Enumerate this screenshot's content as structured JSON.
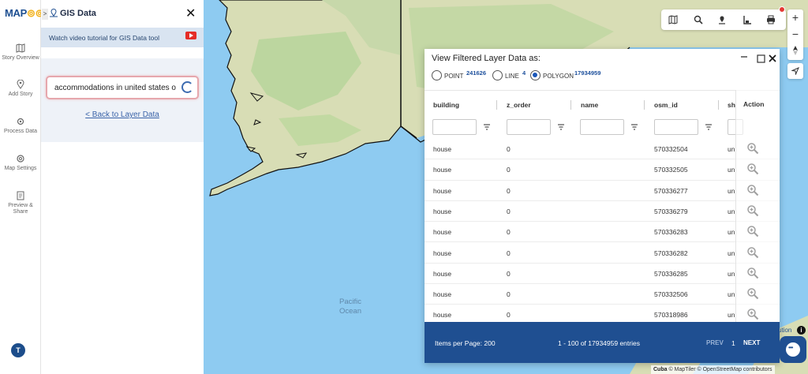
{
  "app": {
    "logo_prefix": "MAP",
    "logo_suffix": "O"
  },
  "rail": {
    "items": [
      {
        "label": "Story Overview",
        "icon": "map-icon"
      },
      {
        "label": "Add Story",
        "icon": "pin-icon"
      },
      {
        "label": "Process Data",
        "icon": "gear-icon"
      },
      {
        "label": "Map Settings",
        "icon": "settings-icon"
      },
      {
        "label": "Preview & Share",
        "icon": "preview-icon"
      }
    ],
    "avatar_initial": "T"
  },
  "panel": {
    "chevron": ">",
    "title": "GIS Data",
    "close": "✕",
    "tutorial_text": "Watch video tutorial for GIS Data tool",
    "search_value": "accommodations in united states o",
    "back_link": "< Back to Layer Data"
  },
  "dialog": {
    "title": "View Filtered Layer Data as:",
    "radios": [
      {
        "label": "POINT",
        "count": "241626",
        "selected": false
      },
      {
        "label": "LINE",
        "count": "4",
        "selected": false
      },
      {
        "label": "POLYGON",
        "count": "17934959",
        "selected": true
      }
    ],
    "columns": [
      "building",
      "z_order",
      "name",
      "osm_id",
      "sh",
      "Action"
    ],
    "rows": [
      {
        "building": "house",
        "z_order": "0",
        "name": "",
        "osm_id": "570332504",
        "sh": "un"
      },
      {
        "building": "house",
        "z_order": "0",
        "name": "",
        "osm_id": "570332505",
        "sh": "un"
      },
      {
        "building": "house",
        "z_order": "0",
        "name": "",
        "osm_id": "570336277",
        "sh": "un"
      },
      {
        "building": "house",
        "z_order": "0",
        "name": "",
        "osm_id": "570336279",
        "sh": "un"
      },
      {
        "building": "house",
        "z_order": "0",
        "name": "",
        "osm_id": "570336283",
        "sh": "un"
      },
      {
        "building": "house",
        "z_order": "0",
        "name": "",
        "osm_id": "570336282",
        "sh": "un"
      },
      {
        "building": "house",
        "z_order": "0",
        "name": "",
        "osm_id": "570336285",
        "sh": "un"
      },
      {
        "building": "house",
        "z_order": "0",
        "name": "",
        "osm_id": "570332506",
        "sh": "un"
      },
      {
        "building": "house",
        "z_order": "0",
        "name": "",
        "osm_id": "570318986",
        "sh": "un"
      }
    ],
    "footer": {
      "items_per_page": "Items per Page: 200",
      "entries": "1 - 100 of 17934959 entries",
      "prev": "PREV",
      "page": "1",
      "next": "NEXT"
    }
  },
  "map": {
    "ocean_label_1": "Pacific",
    "ocean_label_2": "Ocean",
    "attribution_partial": "ution",
    "attribution_place": "Cuba",
    "attribution_text": "© MapTiler © OpenStreetMap contributors",
    "zoom_in": "+",
    "zoom_out": "−"
  },
  "colors": {
    "brand": "#1f4f91",
    "accent": "#f2b21f",
    "ocean": "#8ecbf1",
    "land": "#d8ddb5",
    "forest": "#b7d39a"
  }
}
